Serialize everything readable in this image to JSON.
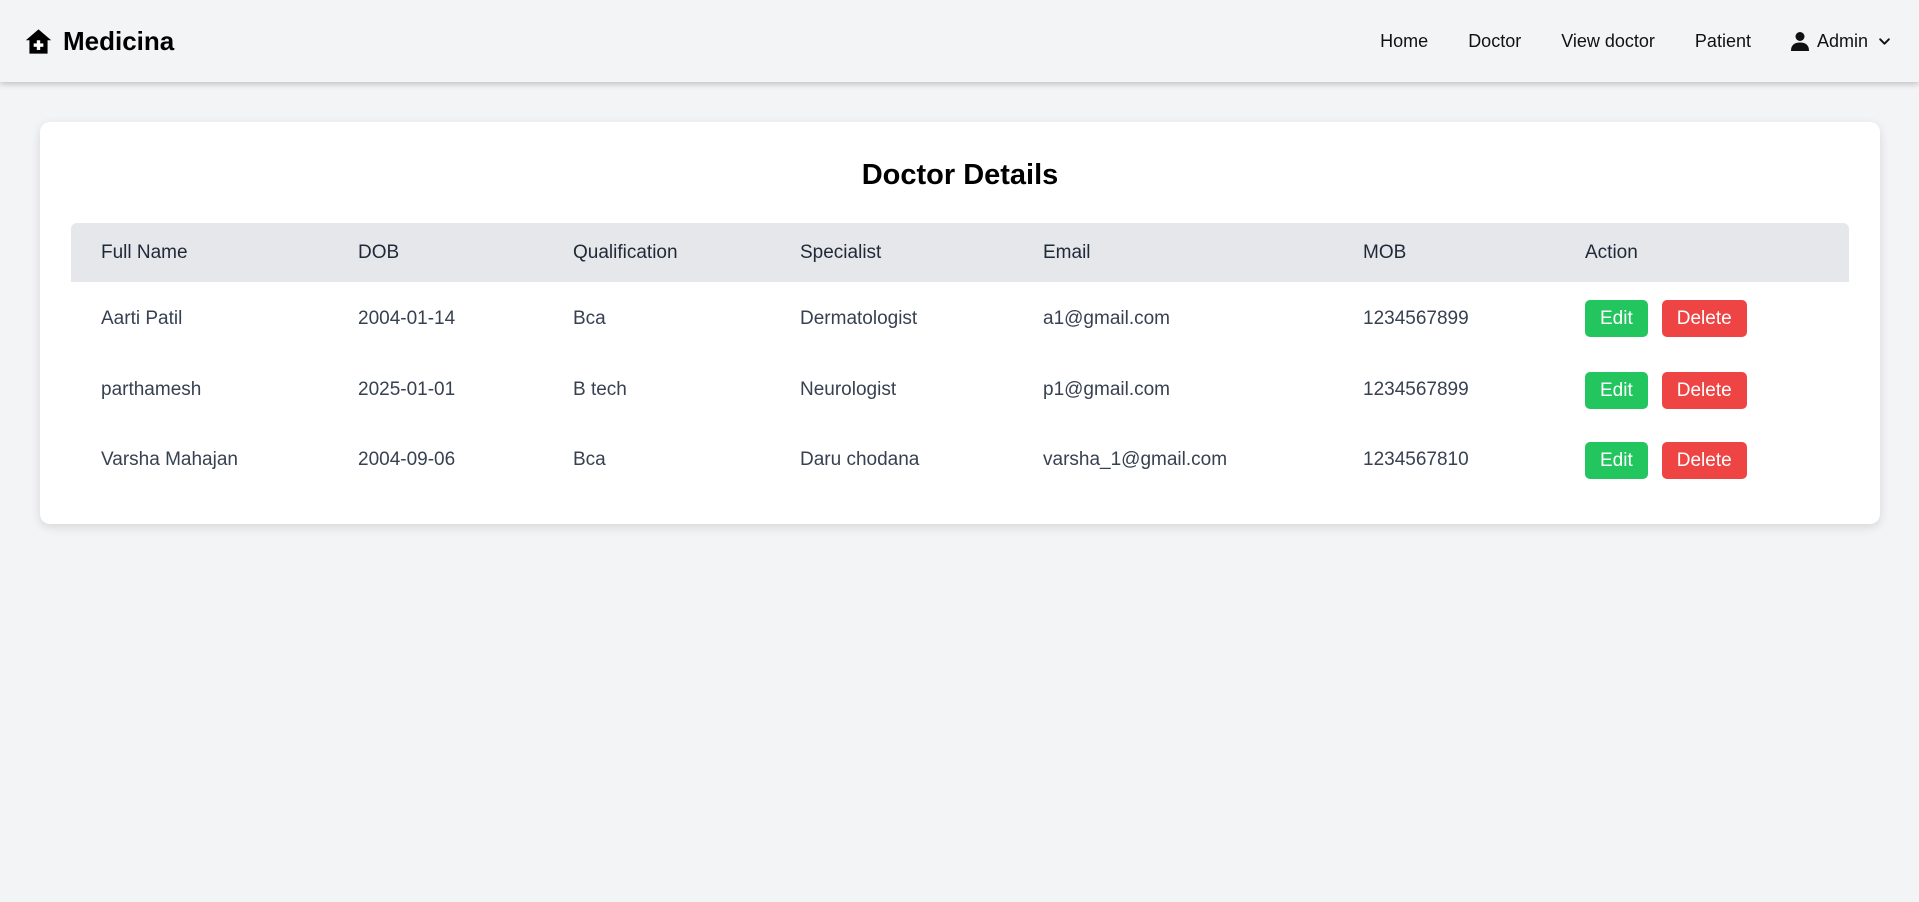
{
  "app": {
    "brand_name": "Medicina",
    "brand_icon": "home-medical-icon"
  },
  "nav": {
    "items": [
      {
        "label": "Home"
      },
      {
        "label": "Doctor"
      },
      {
        "label": "View doctor"
      },
      {
        "label": "Patient"
      }
    ],
    "user_label": "Admin",
    "user_icon": "user-icon",
    "dropdown_icon": "chevron-down-icon"
  },
  "main": {
    "title": "Doctor Details",
    "table": {
      "columns": [
        "Full Name",
        "DOB",
        "Qualification",
        "Specialist",
        "Email",
        "MOB",
        "Action"
      ],
      "rows": [
        {
          "name": "Aarti Patil",
          "dob": "2004-01-14",
          "qualification": "Bca",
          "specialist": "Dermatologist",
          "email": "a1@gmail.com",
          "mob": "1234567899"
        },
        {
          "name": "parthamesh",
          "dob": "2025-01-01",
          "qualification": "B tech",
          "specialist": "Neurologist",
          "email": "p1@gmail.com",
          "mob": "1234567899"
        },
        {
          "name": "Varsha Mahajan",
          "dob": "2004-09-06",
          "qualification": "Bca",
          "specialist": "Daru chodana",
          "email": "varsha_1@gmail.com",
          "mob": "1234567810"
        }
      ],
      "edit_label": "Edit",
      "delete_label": "Delete"
    }
  },
  "colors": {
    "background": "#f3f4f6",
    "header_row": "#e5e7eb",
    "edit": "#22c55e",
    "delete": "#ef4444"
  }
}
